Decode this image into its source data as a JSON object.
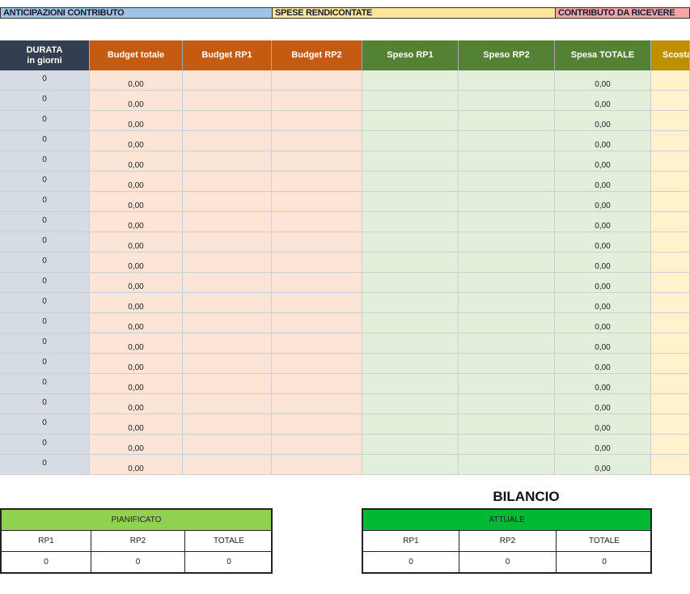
{
  "bands": [
    {
      "label": "ANTICIPAZIONI CONTRIBUTO",
      "color": "#9dc3e6"
    },
    {
      "label": "SPESE RENDICONTATE",
      "color": "#ffe699"
    },
    {
      "label": "CONTRIBUTO DA RICEVERE",
      "color": "#f4a6a6"
    }
  ],
  "columns": [
    {
      "label": "DURATA\nin giorni",
      "header_color": "#333f50",
      "fill": "#d6dce4"
    },
    {
      "label": "Budget totale",
      "header_color": "#c55a11",
      "fill": "#fce4d6"
    },
    {
      "label": "Budget RP1",
      "header_color": "#c55a11",
      "fill": "#fce4d6"
    },
    {
      "label": "Budget RP2",
      "header_color": "#c55a11",
      "fill": "#fce4d6"
    },
    {
      "label": "Speso RP1",
      "header_color": "#548235",
      "fill": "#e2efda"
    },
    {
      "label": "Speso RP2",
      "header_color": "#548235",
      "fill": "#e2efda"
    },
    {
      "label": "Spesa TOTALE",
      "header_color": "#548235",
      "fill": "#e2efda"
    },
    {
      "label": "Scosta",
      "header_color": "#bf8f00",
      "fill": "#fff2cc"
    }
  ],
  "rows": [
    [
      "0",
      "0,00",
      "",
      "",
      "",
      "",
      "0,00",
      ""
    ],
    [
      "0",
      "0,00",
      "",
      "",
      "",
      "",
      "0,00",
      ""
    ],
    [
      "0",
      "0,00",
      "",
      "",
      "",
      "",
      "0,00",
      ""
    ],
    [
      "0",
      "0,00",
      "",
      "",
      "",
      "",
      "0,00",
      ""
    ],
    [
      "0",
      "0,00",
      "",
      "",
      "",
      "",
      "0,00",
      ""
    ],
    [
      "0",
      "0,00",
      "",
      "",
      "",
      "",
      "0,00",
      ""
    ],
    [
      "0",
      "0,00",
      "",
      "",
      "",
      "",
      "0,00",
      ""
    ],
    [
      "0",
      "0,00",
      "",
      "",
      "",
      "",
      "0,00",
      ""
    ],
    [
      "0",
      "0,00",
      "",
      "",
      "",
      "",
      "0,00",
      ""
    ],
    [
      "0",
      "0,00",
      "",
      "",
      "",
      "",
      "0,00",
      ""
    ],
    [
      "0",
      "0,00",
      "",
      "",
      "",
      "",
      "0,00",
      ""
    ],
    [
      "0",
      "0,00",
      "",
      "",
      "",
      "",
      "0,00",
      ""
    ],
    [
      "0",
      "0,00",
      "",
      "",
      "",
      "",
      "0,00",
      ""
    ],
    [
      "0",
      "0,00",
      "",
      "",
      "",
      "",
      "0,00",
      ""
    ],
    [
      "0",
      "0,00",
      "",
      "",
      "",
      "",
      "0,00",
      ""
    ],
    [
      "0",
      "0,00",
      "",
      "",
      "",
      "",
      "0,00",
      ""
    ],
    [
      "0",
      "0,00",
      "",
      "",
      "",
      "",
      "0,00",
      ""
    ],
    [
      "0",
      "0,00",
      "",
      "",
      "",
      "",
      "0,00",
      ""
    ],
    [
      "0",
      "0,00",
      "",
      "",
      "",
      "",
      "0,00",
      ""
    ],
    [
      "0",
      "0,00",
      "",
      "",
      "",
      "",
      "0,00",
      ""
    ]
  ],
  "bilancio": {
    "title": "BILANCIO",
    "pianificato": {
      "title": "PIANIFICATO",
      "color": "#92d050",
      "headers": [
        "RP1",
        "RP2",
        "TOTALE"
      ],
      "values": [
        "0",
        "0",
        "0"
      ]
    },
    "attuale": {
      "title": "ATTUALE",
      "color": "#00b933",
      "headers": [
        "RP1",
        "RP2",
        "TOTALE"
      ],
      "values": [
        "0",
        "0",
        "0"
      ]
    }
  }
}
